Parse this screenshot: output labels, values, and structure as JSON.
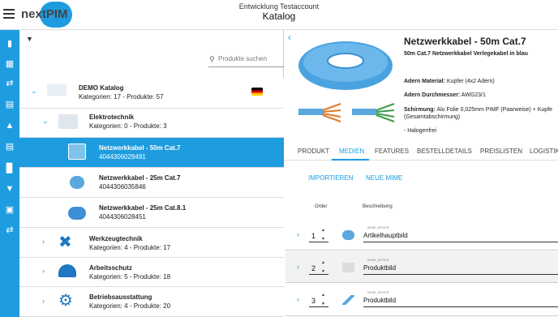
{
  "header": {
    "logo": "nextPIM",
    "account": "Entwicklung Testaccount",
    "title": "Katalog"
  },
  "sidebar": {
    "icons": [
      "book-icon",
      "calendar-icon",
      "shuffle-icon",
      "box-icon",
      "warning-icon",
      "document-icon",
      "bar-chart-icon",
      "filter-icon",
      "printer-icon",
      "shuffle-icon"
    ]
  },
  "tree": {
    "search_placeholder": "Produkte suchen",
    "items": [
      {
        "name": "DEMO Katalog",
        "sub": "Kategorien: 17 - Produkte: 57"
      },
      {
        "name": "Elektrotechnik",
        "sub": "Kategorien: 0 - Produkte: 3"
      },
      {
        "name": "Netzwerkkabel - 50m Cat.7",
        "sub": "4044306029491"
      },
      {
        "name": "Netzwerkkabel - 25m Cat.7",
        "sub": "4044306035846"
      },
      {
        "name": "Netzwerkkabel - 25m Cat.8.1",
        "sub": "4044306028451"
      },
      {
        "name": "Werkzeugtechnik",
        "sub": "Kategorien: 4 - Produkte: 17"
      },
      {
        "name": "Arbeitsschutz",
        "sub": "Kategorien: 5 - Produkte: 18"
      },
      {
        "name": "Betriebsausstattung",
        "sub": "Kategorien: 4 - Produkte: 20"
      }
    ]
  },
  "product": {
    "title": "Netzwerkkabel - 50m Cat.7",
    "subtitle": "50m Cat.7 Netzwerkkabel Verlegekabel in blau",
    "attr1_label": "Adern Material:",
    "attr1_value": " Kupfer (4x2 Adern)",
    "attr2_label": "Adern Durchmesser:",
    "attr2_value": " AWG23/1",
    "attr3_label": "Schirmung:",
    "attr3_value": " Alu Folie 0,025mm PIMF (Paarweise) + Kupfe",
    "attr3_cont": "(Gesamtabschirmung)",
    "attr4": "- Halogenfrei"
  },
  "tabs": [
    "PRODUKT",
    "MEDIEN",
    "FEATURES",
    "BESTELLDETAILS",
    "PREISLISTEN",
    "LOGISTIK"
  ],
  "media": {
    "import_label": "IMPORTIEREN",
    "new_label": "NEUE MIME",
    "col_order": "Order",
    "col_desc": "Beschreibung",
    "rows": [
      {
        "order": "1",
        "label": "MIME_DESCR",
        "value": "Artikelhauptbild"
      },
      {
        "order": "2",
        "label": "MIME_DESCR",
        "value": "Produktbild"
      },
      {
        "order": "3",
        "label": "MIME_DESCR",
        "value": "Produktbild"
      }
    ]
  },
  "colors": {
    "accent": "#1e9ce0"
  }
}
